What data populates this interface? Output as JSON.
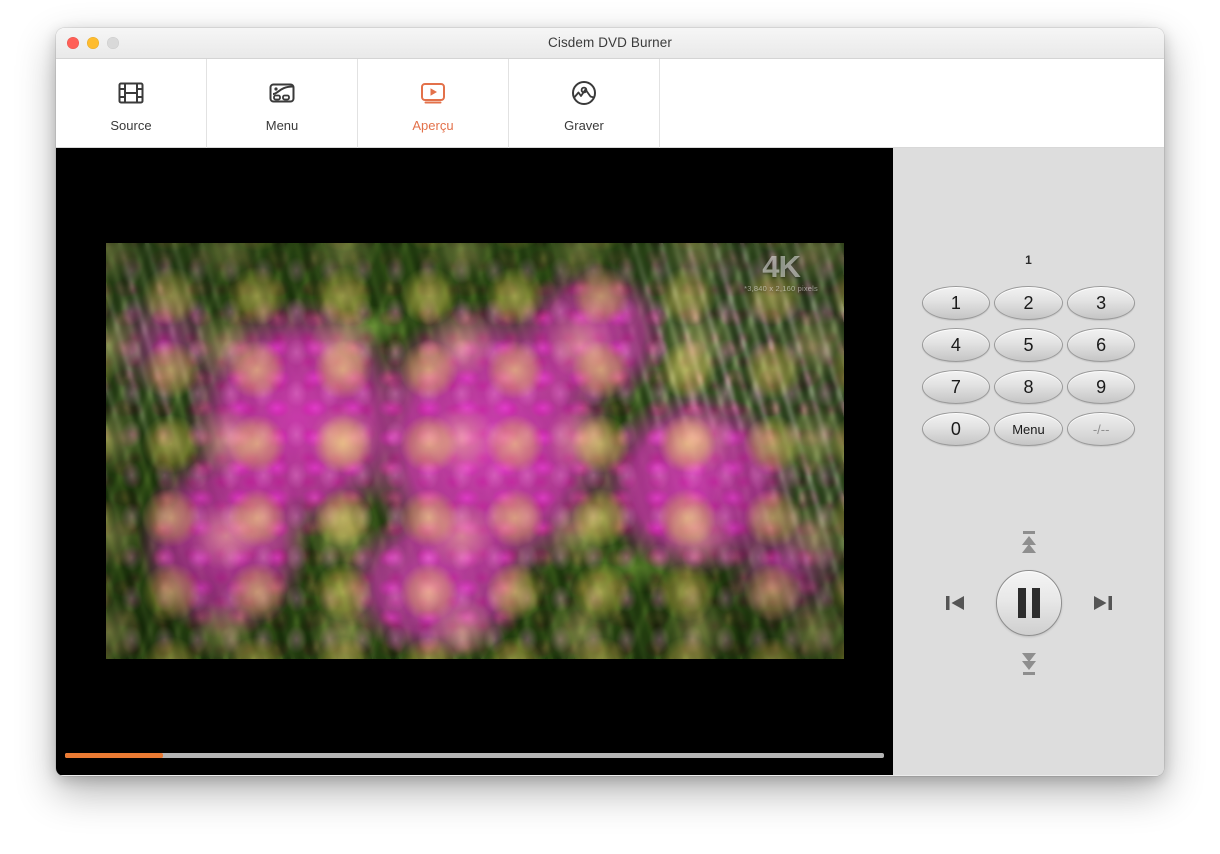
{
  "window": {
    "title": "Cisdem DVD Burner",
    "traffic_lights": [
      {
        "name": "close",
        "color": "#ff5f57",
        "enabled": true
      },
      {
        "name": "minimize",
        "color": "#febc2e",
        "enabled": true
      },
      {
        "name": "zoom",
        "color": "#d9d9d9",
        "enabled": false
      }
    ]
  },
  "toolbar": {
    "active_tab": "Aperçu",
    "accent_color": "#e3714a",
    "tabs": [
      {
        "label": "Source",
        "icon": "film-strip-icon",
        "active": false
      },
      {
        "label": "Menu",
        "icon": "dvd-menu-icon",
        "active": false
      },
      {
        "label": "Aperçu",
        "icon": "preview-play-icon",
        "active": true
      },
      {
        "label": "Graver",
        "icon": "burn-disc-icon",
        "active": false
      }
    ]
  },
  "player": {
    "watermark": {
      "title": "4K",
      "subtitle": "*3,840 x 2,160 pixels"
    },
    "progress": {
      "percent": 12,
      "fill_color": "#ea7a33",
      "track_color": "#b4b4b4"
    },
    "background_color": "#000000"
  },
  "remote": {
    "chapter_display": "1",
    "keypad": [
      {
        "label": "1",
        "kind": "digit"
      },
      {
        "label": "2",
        "kind": "digit"
      },
      {
        "label": "3",
        "kind": "digit"
      },
      {
        "label": "4",
        "kind": "digit"
      },
      {
        "label": "5",
        "kind": "digit"
      },
      {
        "label": "6",
        "kind": "digit"
      },
      {
        "label": "7",
        "kind": "digit"
      },
      {
        "label": "8",
        "kind": "digit"
      },
      {
        "label": "9",
        "kind": "digit"
      },
      {
        "label": "0",
        "kind": "digit"
      },
      {
        "label": "Menu",
        "kind": "menu"
      },
      {
        "label": "-/--",
        "kind": "dim"
      }
    ],
    "transport": {
      "play_pause": "pause-icon",
      "previous": "previous-track-icon",
      "next": "next-track-icon",
      "up": "previous-chapter-icon",
      "down": "next-chapter-icon"
    }
  }
}
